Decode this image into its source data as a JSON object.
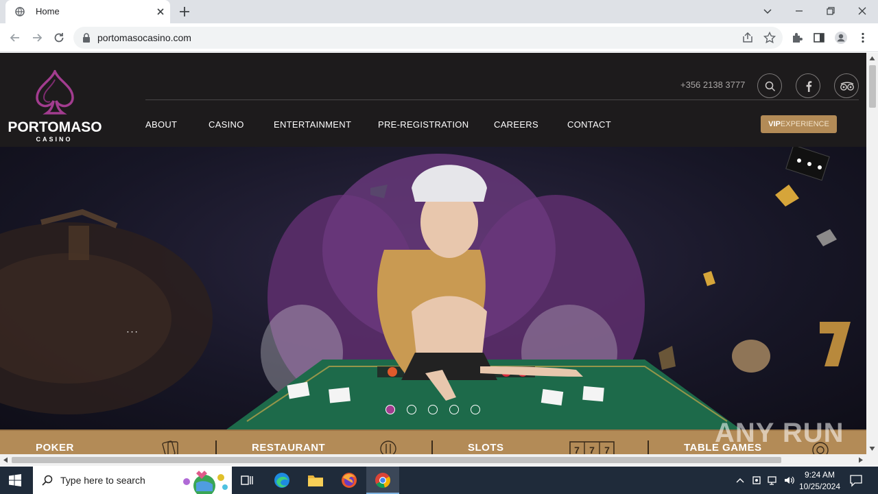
{
  "browser": {
    "tab_title": "Home",
    "url": "portomasocasino.com"
  },
  "site": {
    "logo_word": "PORTOMASO",
    "logo_sub": "CASINO",
    "phone": "+356 2138 3777",
    "nav": [
      "ABOUT",
      "CASINO",
      "ENTERTAINMENT",
      "PRE-REGISTRATION",
      "CAREERS",
      "CONTACT"
    ],
    "vip_bold": "VIP",
    "vip_light": "EXPERIENCE",
    "hero_caption": "·  ·  ·",
    "slider_dots": 5,
    "active_dot": 0,
    "categories": [
      "POKER",
      "RESTAURANT",
      "SLOTS",
      "TABLE GAMES"
    ],
    "accent": "#b38b57",
    "brand_purple": "#9b3a8c"
  },
  "watermark": "ANY RUN",
  "taskbar": {
    "search_placeholder": "Type here to search",
    "time": "9:24 AM",
    "date": "10/25/2024"
  }
}
